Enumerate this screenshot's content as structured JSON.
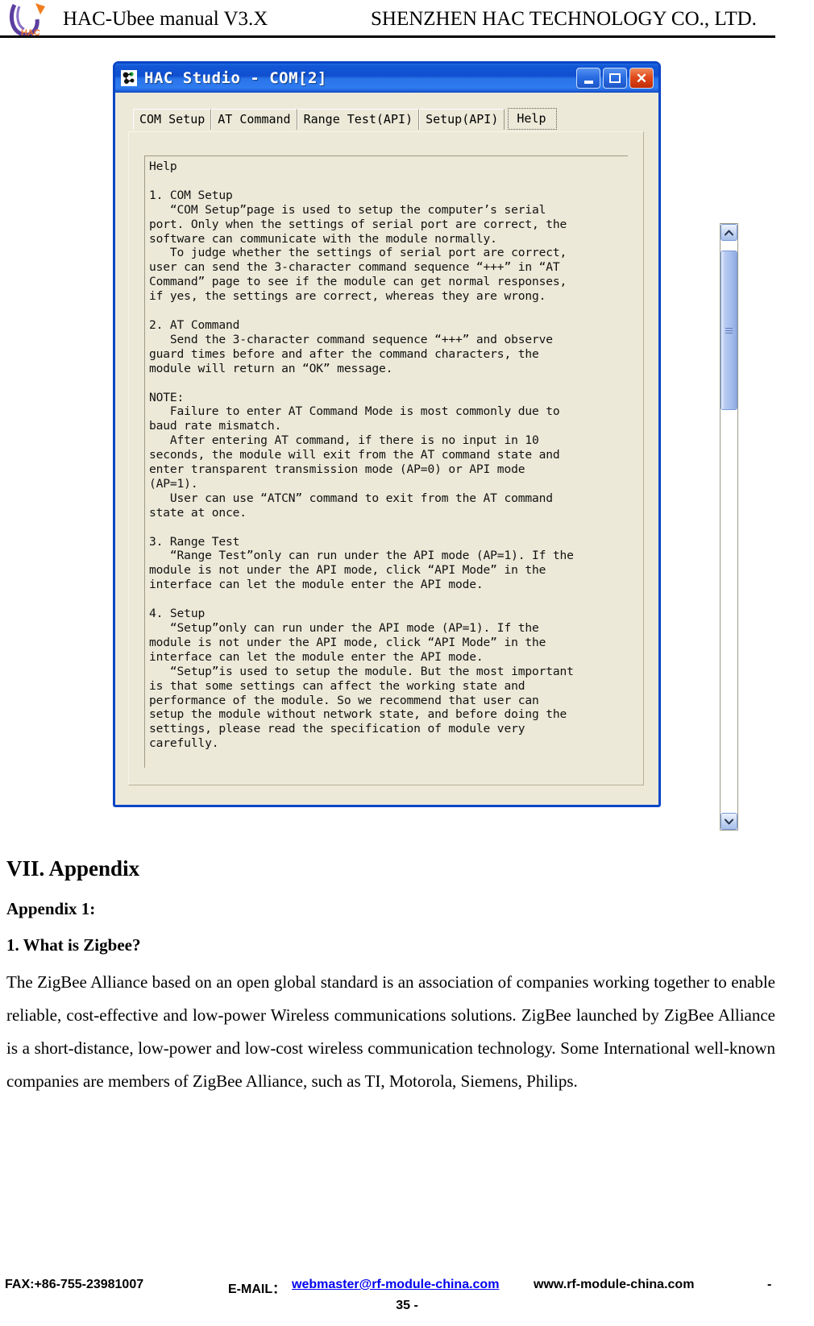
{
  "header": {
    "left_title": "HAC-Ubee manual V3.X",
    "right_title": "SHENZHEN HAC TECHNOLOGY CO., LTD.",
    "logo_text": "HAC"
  },
  "window": {
    "title": "HAC Studio - COM[2]",
    "buttons": {
      "minimize": "_",
      "maximize": "□",
      "close": "✕"
    },
    "tabs": [
      {
        "label": "COM Setup",
        "active": false
      },
      {
        "label": "AT Command",
        "active": false
      },
      {
        "label": "Range Test(API)",
        "active": false
      },
      {
        "label": "Setup(API)",
        "active": false
      },
      {
        "label": "Help",
        "active": true
      }
    ],
    "help_text": "Help\n\n1. COM Setup\n   “COM Setup”page is used to setup the computer’s serial\nport. Only when the settings of serial port are correct, the\nsoftware can communicate with the module normally.\n   To judge whether the settings of serial port are correct,\nuser can send the 3-character command sequence “+++” in “AT\nCommand” page to see if the module can get normal responses,\nif yes, the settings are correct, whereas they are wrong.\n\n2. AT Command\n   Send the 3-character command sequence “+++” and observe\nguard times before and after the command characters, the\nmodule will return an “OK” message.\n\nNOTE:\n   Failure to enter AT Command Mode is most commonly due to\nbaud rate mismatch.\n   After entering AT command, if there is no input in 10\nseconds, the module will exit from the AT command state and\nenter transparent transmission mode (AP=0) or API mode\n(AP=1).\n   User can use “ATCN” command to exit from the AT command\nstate at once.\n\n3. Range Test\n   “Range Test”only can run under the API mode (AP=1). If the\nmodule is not under the API mode, click “API Mode” in the\ninterface can let the module enter the API mode.\n\n4. Setup\n   “Setup”only can run under the API mode (AP=1). If the\nmodule is not under the API mode, click “API Mode” in the\ninterface can let the module enter the API mode.\n   “Setup”is used to setup the module. But the most important\nis that some settings can affect the working state and\nperformance of the module. So we recommend that user can\nsetup the module without network state, and before doing the\nsettings, please read the specification of module very\ncarefully.",
    "scrollbar": {
      "up_arrow": "▲",
      "down_arrow": "▼"
    }
  },
  "document": {
    "section_heading": "VII.  Appendix",
    "appendix_label": "Appendix 1:",
    "question_heading": "1. What is Zigbee?",
    "paragraph": "The ZigBee Alliance based on an open global standard is an association of companies working together to enable reliable, cost-effective and low-power Wireless communications solutions. ZigBee launched by ZigBee Alliance is a short-distance, low-power and low-cost wireless communication technology. Some International well-known companies are members of ZigBee Alliance, such as TI, Motorola, Siemens, Philips."
  },
  "footer": {
    "fax": "FAX:+86-755-23981007",
    "email_label": "E-MAIL：",
    "email_link": "webmaster@rf-module-china.com",
    "website": "www.rf-module-china.com",
    "dash": "-",
    "page_number": "35 -"
  }
}
